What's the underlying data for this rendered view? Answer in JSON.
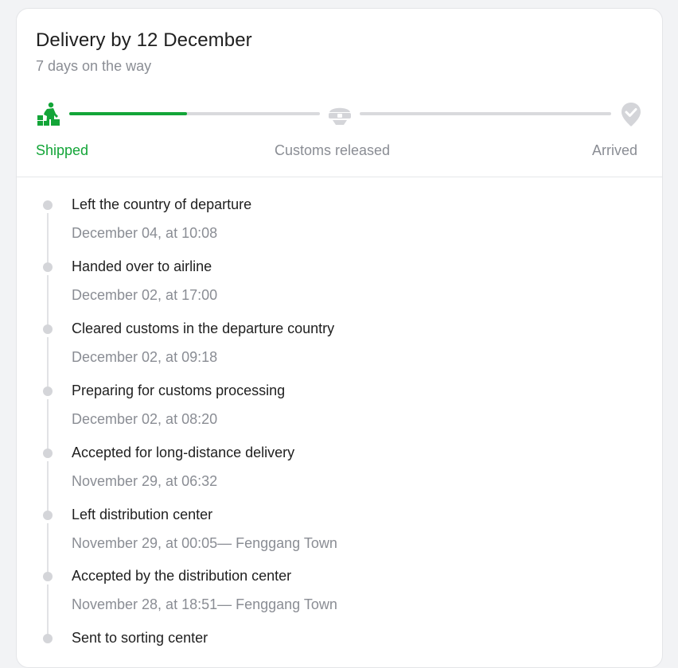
{
  "header": {
    "title": "Delivery by 12 December",
    "subtitle": "7 days on the way"
  },
  "progress": {
    "stages": [
      {
        "label": "Shipped",
        "icon": "shipped-icon",
        "state": "done"
      },
      {
        "label": "Customs released",
        "icon": "customs-icon",
        "state": "pending"
      },
      {
        "label": "Arrived",
        "icon": "arrived-pin-icon",
        "state": "pending"
      }
    ],
    "segment1_fraction": 0.47,
    "segment2_fraction": 0.0,
    "colors": {
      "active": "#13a538",
      "inactive": "#d9dadd",
      "muted_text": "#8a8d94"
    }
  },
  "events": [
    {
      "title": "Left the country of departure",
      "meta": "December 04, at 10:08"
    },
    {
      "title": "Handed over to airline",
      "meta": "December 02, at 17:00"
    },
    {
      "title": "Cleared customs in the departure country",
      "meta": "December 02, at 09:18"
    },
    {
      "title": "Preparing for customs processing",
      "meta": "December 02, at 08:20"
    },
    {
      "title": "Accepted for long-distance delivery",
      "meta": "November 29, at 06:32"
    },
    {
      "title": "Left distribution center",
      "meta": "November 29, at 00:05— Fenggang Town"
    },
    {
      "title": "Accepted by the distribution center",
      "meta": "November 28, at 18:51— Fenggang Town"
    },
    {
      "title": "Sent to sorting center",
      "meta": ""
    }
  ]
}
